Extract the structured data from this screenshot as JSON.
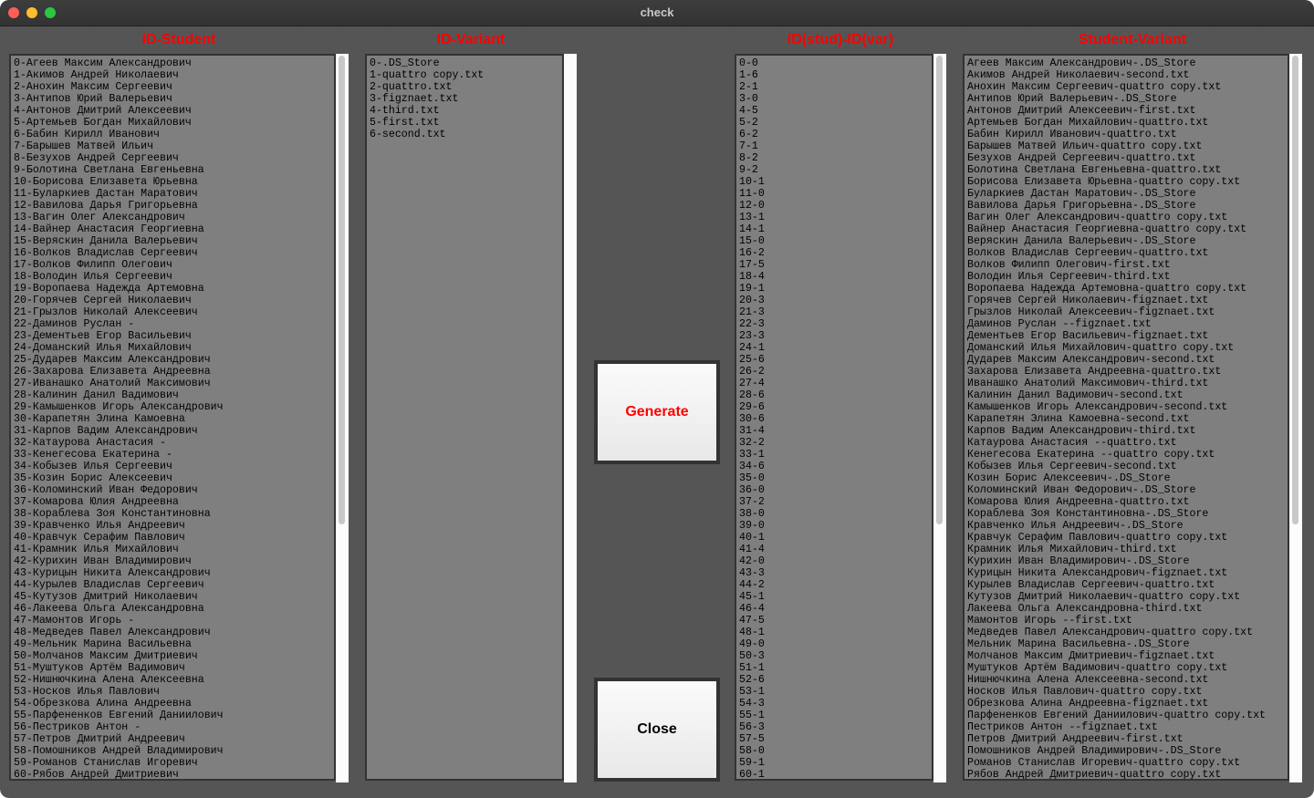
{
  "window": {
    "title": "check"
  },
  "headers": {
    "students": "ID-Student",
    "variants": "ID-Variant",
    "mapping": "ID(stud)-ID(var)",
    "result": "Student-Variant"
  },
  "buttons": {
    "generate": "Generate",
    "close": "Close"
  },
  "students": [
    "0-Агеев Максим Александрович",
    "1-Акимов Андрей Николаевич",
    "2-Анохин Максим Сергеевич",
    "3-Антипов Юрий Валерьевич",
    "4-Антонов Дмитрий Алексеевич",
    "5-Артемьев Богдан Михайлович",
    "6-Бабин Кирилл Иванович",
    "7-Барышев Матвей Ильич",
    "8-Безухов Андрей Сергеевич",
    "9-Болотина Светлана Евгеньевна",
    "10-Борисова Елизавета Юрьевна",
    "11-Буларкиев Дастан Маратович",
    "12-Вавилова Дарья Григорьевна",
    "13-Вагин Олег Александрович",
    "14-Вайнер Анастасия Георгиевна",
    "15-Веряскин Данила Валерьевич",
    "16-Волков Владислав Сергеевич",
    "17-Волков Филипп Олегович",
    "18-Володин Илья Сергеевич",
    "19-Воропаева Надежда Артемовна",
    "20-Горячев Сергей Николаевич",
    "21-Грызлов Николай Алексеевич",
    "22-Даминов Руслан -",
    "23-Дементьев Егор Васильевич",
    "24-Доманский Илья Михайлович",
    "25-Дударев Максим Александрович",
    "26-Захарова Елизавета Андреевна",
    "27-Иванашко Анатолий Максимович",
    "28-Калинин Данил Вадимович",
    "29-Камышенков Игорь Александрович",
    "30-Карапетян Элина Камоевна",
    "31-Карпов Вадим Александрович",
    "32-Катаурова Анастасия -",
    "33-Кенегесова Екатерина -",
    "34-Кобызев Илья Сергеевич",
    "35-Козин Борис Алексеевич",
    "36-Коломинский Иван Федорович",
    "37-Комарова Юлия Андреевна",
    "38-Кораблева Зоя Константиновна",
    "39-Кравченко Илья Андреевич",
    "40-Кравчук Серафим Павлович",
    "41-Крамник Илья Михайлович",
    "42-Курихин Иван Владимирович",
    "43-Курицын Никита Александрович",
    "44-Курылев Владислав Сергеевич",
    "45-Кутузов Дмитрий Николаевич",
    "46-Лакеева Ольга Александровна",
    "47-Мамонтов Игорь -",
    "48-Медведев Павел Александрович",
    "49-Мельник Марина Васильевна",
    "50-Молчанов Максим Дмитриевич",
    "51-Муштуков Артём Вадимович",
    "52-Нишнючкина Алена Алексеевна",
    "53-Носков Илья Павлович",
    "54-Обрезкова Алина Андреевна",
    "55-Парфененков Евгений Даниилович",
    "56-Пестриков Антон -",
    "57-Петров Дмитрий Андреевич",
    "58-Помошников Андрей Владимирович",
    "59-Романов Станислав Игоревич",
    "60-Рябов Андрей Дмитриевич"
  ],
  "variants": [
    "0-.DS_Store",
    "1-quattro copy.txt",
    "2-quattro.txt",
    "3-figznaet.txt",
    "4-third.txt",
    "5-first.txt",
    "6-second.txt"
  ],
  "mapping": [
    "0-0",
    "1-6",
    "2-1",
    "3-0",
    "4-5",
    "5-2",
    "6-2",
    "7-1",
    "8-2",
    "9-2",
    "10-1",
    "11-0",
    "12-0",
    "13-1",
    "14-1",
    "15-0",
    "16-2",
    "17-5",
    "18-4",
    "19-1",
    "20-3",
    "21-3",
    "22-3",
    "23-3",
    "24-1",
    "25-6",
    "26-2",
    "27-4",
    "28-6",
    "29-6",
    "30-6",
    "31-4",
    "32-2",
    "33-1",
    "34-6",
    "35-0",
    "36-0",
    "37-2",
    "38-0",
    "39-0",
    "40-1",
    "41-4",
    "42-0",
    "43-3",
    "44-2",
    "45-1",
    "46-4",
    "47-5",
    "48-1",
    "49-0",
    "50-3",
    "51-1",
    "52-6",
    "53-1",
    "54-3",
    "55-1",
    "56-3",
    "57-5",
    "58-0",
    "59-1",
    "60-1"
  ],
  "result": [
    "Агеев Максим Александрович-.DS_Store",
    "Акимов Андрей Николаевич-second.txt",
    "Анохин Максим Сергеевич-quattro copy.txt",
    "Антипов Юрий Валерьевич-.DS_Store",
    "Антонов Дмитрий Алексеевич-first.txt",
    "Артемьев Богдан Михайлович-quattro.txt",
    "Бабин Кирилл Иванович-quattro.txt",
    "Барышев Матвей Ильич-quattro copy.txt",
    "Безухов Андрей Сергеевич-quattro.txt",
    "Болотина Светлана Евгеньевна-quattro.txt",
    "Борисова Елизавета Юрьевна-quattro copy.txt",
    "Буларкиев Дастан Маратович-.DS_Store",
    "Вавилова Дарья Григорьевна-.DS_Store",
    "Вагин Олег Александрович-quattro copy.txt",
    "Вайнер Анастасия Георгиевна-quattro copy.txt",
    "Веряскин Данила Валерьевич-.DS_Store",
    "Волков Владислав Сергеевич-quattro.txt",
    "Волков Филипп Олегович-first.txt",
    "Володин Илья Сергеевич-third.txt",
    "Воропаева Надежда Артемовна-quattro copy.txt",
    "Горячев Сергей Николаевич-figznaet.txt",
    "Грызлов Николай Алексеевич-figznaet.txt",
    "Даминов Руслан --figznaet.txt",
    "Дементьев Егор Васильевич-figznaet.txt",
    "Доманский Илья Михайлович-quattro copy.txt",
    "Дударев Максим Александрович-second.txt",
    "Захарова Елизавета Андреевна-quattro.txt",
    "Иванашко Анатолий Максимович-third.txt",
    "Калинин Данил Вадимович-second.txt",
    "Камышенков Игорь Александрович-second.txt",
    "Карапетян Элина Камоевна-second.txt",
    "Карпов Вадим Александрович-third.txt",
    "Катаурова Анастасия --quattro.txt",
    "Кенегесова Екатерина --quattro copy.txt",
    "Кобызев Илья Сергеевич-second.txt",
    "Козин Борис Алексеевич-.DS_Store",
    "Коломинский Иван Федорович-.DS_Store",
    "Комарова Юлия Андреевна-quattro.txt",
    "Кораблева Зоя Константиновна-.DS_Store",
    "Кравченко Илья Андреевич-.DS_Store",
    "Кравчук Серафим Павлович-quattro copy.txt",
    "Крамник Илья Михайлович-third.txt",
    "Курихин Иван Владимирович-.DS_Store",
    "Курицын Никита Александрович-figznaet.txt",
    "Курылев Владислав Сергеевич-quattro.txt",
    "Кутузов Дмитрий Николаевич-quattro copy.txt",
    "Лакеева Ольга Александровна-third.txt",
    "Мамонтов Игорь --first.txt",
    "Медведев Павел Александрович-quattro copy.txt",
    "Мельник Марина Васильевна-.DS_Store",
    "Молчанов Максим Дмитриевич-figznaet.txt",
    "Муштуков Артём Вадимович-quattro copy.txt",
    "Нишнючкина Алена Алексеевна-second.txt",
    "Носков Илья Павлович-quattro copy.txt",
    "Обрезкова Алина Андреевна-figznaet.txt",
    "Парфененков Евгений Даниилович-quattro copy.txt",
    "Пестриков Антон --figznaet.txt",
    "Петров Дмитрий Андреевич-first.txt",
    "Помошников Андрей Владимирович-.DS_Store",
    "Романов Станислав Игоревич-quattro copy.txt",
    "Рябов Андрей Дмитриевич-quattro copy.txt"
  ]
}
